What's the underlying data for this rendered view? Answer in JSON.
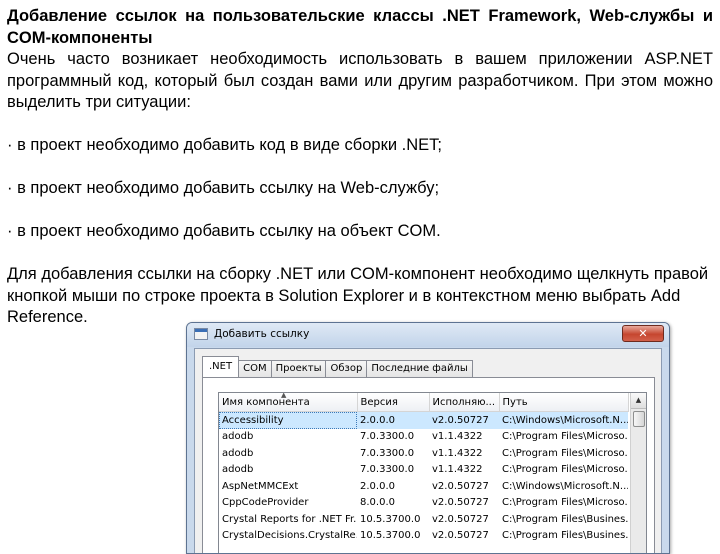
{
  "document": {
    "heading": "Добавление ссылок на пользовательские классы .NET Framework, Web-службы и COM-компоненты",
    "intro": "Очень часто возникает необходимость использовать в вашем приложении ASP.NET программный код, который был создан вами или другим разработчиком. При этом можно выделить три ситуации:",
    "bullets": [
      "· в проект необходимо добавить код в виде сборки .NET;",
      "· в проект необходимо добавить ссылку на Web-службу;",
      "· в проект необходимо добавить ссылку на объект COM."
    ],
    "outro": "Для добавления ссылки на сборку .NET или COM-компонент необходимо щелкнуть правой кнопкой мыши по строке проекта в Solution Explorer и в контекстном меню выбрать Add Reference."
  },
  "dialog": {
    "title": "Добавить ссылку",
    "close_label": "✕",
    "tabs": [
      ".NET",
      "COM",
      "Проекты",
      "Обзор",
      "Последние файлы"
    ],
    "active_tab": ".NET",
    "columns": [
      "Имя компонента",
      "Версия",
      "Исполняю...",
      "Путь"
    ],
    "rows": [
      [
        "Accessibility",
        "2.0.0.0",
        "v2.0.50727",
        "C:\\Windows\\Microsoft.N..."
      ],
      [
        "adodb",
        "7.0.3300.0",
        "v1.1.4322",
        "C:\\Program Files\\Microso..."
      ],
      [
        "adodb",
        "7.0.3300.0",
        "v1.1.4322",
        "C:\\Program Files\\Microso..."
      ],
      [
        "adodb",
        "7.0.3300.0",
        "v1.1.4322",
        "C:\\Program Files\\Microso..."
      ],
      [
        "AspNetMMCExt",
        "2.0.0.0",
        "v2.0.50727",
        "C:\\Windows\\Microsoft.N..."
      ],
      [
        "CppCodeProvider",
        "8.0.0.0",
        "v2.0.50727",
        "C:\\Program Files\\Microso..."
      ],
      [
        "Crystal Reports for .NET Fr...",
        "10.5.3700.0",
        "v2.0.50727",
        "C:\\Program Files\\Busines..."
      ],
      [
        "CrystalDecisions.CrystalRe...",
        "10.5.3700.0",
        "v2.0.50727",
        "C:\\Program Files\\Busines..."
      ]
    ],
    "selected_row": 0
  }
}
